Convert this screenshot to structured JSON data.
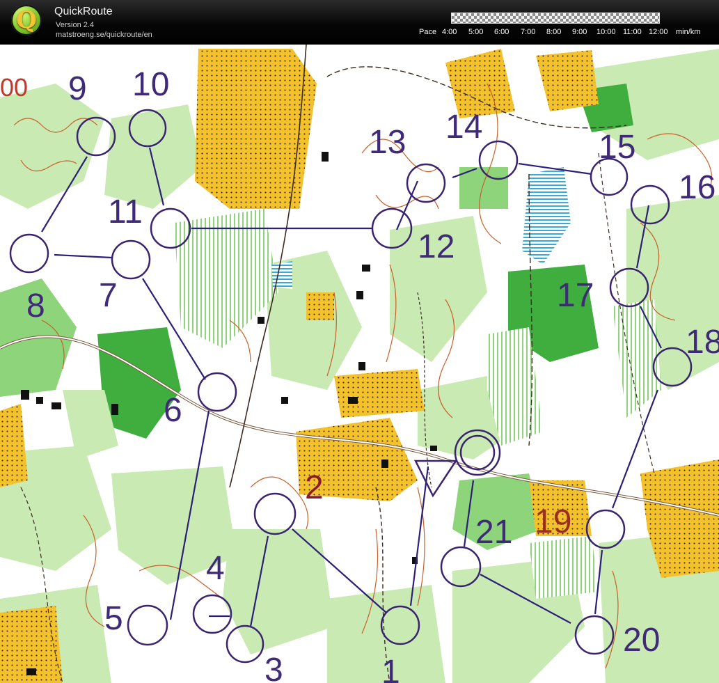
{
  "app": {
    "title": "QuickRoute",
    "version": "Version 2.4",
    "url": "matstroeng.se/quickroute/en",
    "logo_letter": "Q"
  },
  "pace_legend": {
    "label": "Pace",
    "ticks": [
      "4:00",
      "5:00",
      "6:00",
      "7:00",
      "8:00",
      "9:00",
      "10:00",
      "11:00",
      "12:00"
    ],
    "unit": "min/km"
  },
  "map": {
    "corner_fragment": "00",
    "colors": {
      "route": "#2b1f78",
      "control_circle": "#3a2470",
      "yellow_field": "#f3c12c",
      "light_green": "#c9eab2",
      "medium_green": "#8ed47a",
      "dark_green": "#3fae3f",
      "contour": "#c8602a",
      "water": "#3aa9d8",
      "road": "#7a5a40",
      "red_label": "#c0392b"
    },
    "controls": [
      {
        "label": "1",
        "name": "control-1"
      },
      {
        "label": "2",
        "name": "control-2"
      },
      {
        "label": "3",
        "name": "control-3"
      },
      {
        "label": "4",
        "name": "control-4"
      },
      {
        "label": "5",
        "name": "control-5"
      },
      {
        "label": "6",
        "name": "control-6"
      },
      {
        "label": "7",
        "name": "control-7"
      },
      {
        "label": "8",
        "name": "control-8"
      },
      {
        "label": "9",
        "name": "control-9"
      },
      {
        "label": "10",
        "name": "control-10"
      },
      {
        "label": "11",
        "name": "control-11"
      },
      {
        "label": "12",
        "name": "control-12"
      },
      {
        "label": "13",
        "name": "control-13"
      },
      {
        "label": "14",
        "name": "control-14"
      },
      {
        "label": "15",
        "name": "control-15"
      },
      {
        "label": "16",
        "name": "control-16"
      },
      {
        "label": "17",
        "name": "control-17"
      },
      {
        "label": "18",
        "name": "control-18"
      },
      {
        "label": "19",
        "name": "control-19"
      },
      {
        "label": "20",
        "name": "control-20"
      },
      {
        "label": "21",
        "name": "control-21"
      }
    ]
  }
}
